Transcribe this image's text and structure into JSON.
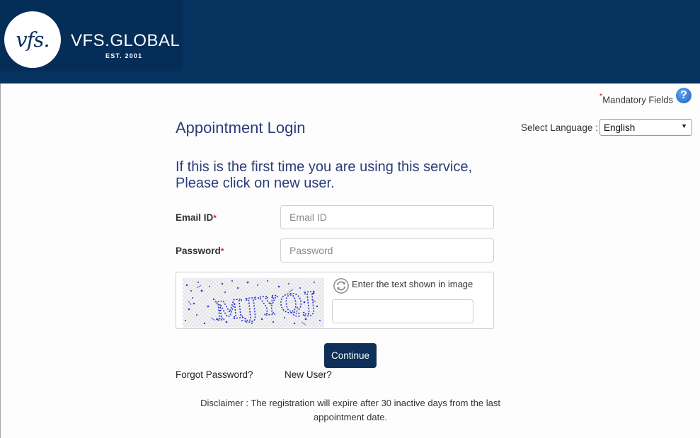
{
  "brand": {
    "monogram": "vfs.",
    "name": "VFS.GLOBAL",
    "established": "EST. 2001",
    "header_color": "#06325f"
  },
  "mandatory": {
    "star": "*",
    "text": "Mandatory Fields",
    "help_icon": "question-mark"
  },
  "title": "Appointment Login",
  "language": {
    "label": "Select Language :",
    "selected": "English"
  },
  "intro": {
    "line1": "If this is the first time you are using this service,",
    "line2": "Please click on new user."
  },
  "form": {
    "email_label": "Email ID",
    "email_placeholder": "Email ID",
    "email_value": "",
    "password_label": "Password",
    "password_placeholder": "Password",
    "password_value": "",
    "required_mark": "*"
  },
  "captcha": {
    "image_text": "MJYQJ",
    "prompt": "Enter the text shown in image",
    "input_value": "",
    "refresh_icon": "refresh-icon"
  },
  "actions": {
    "continue_label": "Continue",
    "forgot_password": "Forgot Password?",
    "new_user": "New User?"
  },
  "disclaimer": {
    "line1": "Disclaimer : The registration will expire after 30 inactive days from the last",
    "line2": "appointment date."
  },
  "colors": {
    "navy": "#06325f",
    "title_blue": "#2b3c7a",
    "button": "#0d2f58",
    "required": "#d0312d"
  }
}
